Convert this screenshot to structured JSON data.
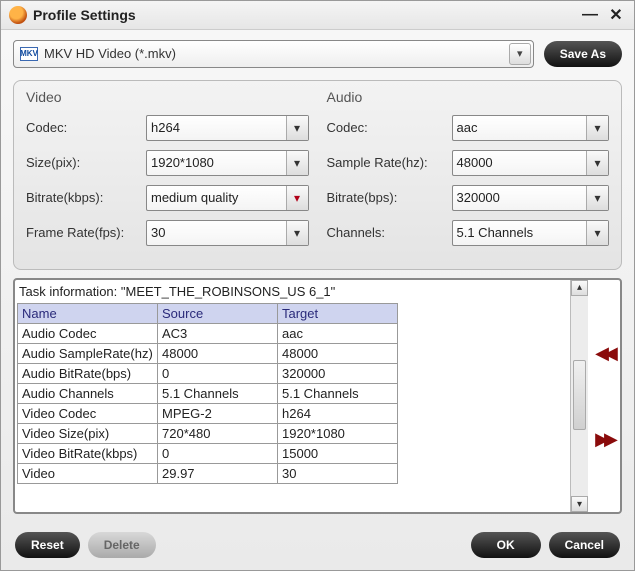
{
  "window": {
    "title": "Profile Settings"
  },
  "toolbar": {
    "profile_value": "MKV HD Video (*.mkv)",
    "save_as_label": "Save As"
  },
  "video": {
    "heading": "Video",
    "codec_label": "Codec:",
    "codec_value": "h264",
    "size_label": "Size(pix):",
    "size_value": "1920*1080",
    "bitrate_label": "Bitrate(kbps):",
    "bitrate_value": "medium quality",
    "fps_label": "Frame Rate(fps):",
    "fps_value": "30"
  },
  "audio": {
    "heading": "Audio",
    "codec_label": "Codec:",
    "codec_value": "aac",
    "sr_label": "Sample Rate(hz):",
    "sr_value": "48000",
    "bitrate_label": "Bitrate(bps):",
    "bitrate_value": "320000",
    "channels_label": "Channels:",
    "channels_value": "5.1 Channels"
  },
  "task": {
    "info": "Task information: \"MEET_THE_ROBINSONS_US 6_1\"",
    "header_name": "Name",
    "header_source": "Source",
    "header_target": "Target",
    "rows": [
      {
        "name": "Audio Codec",
        "source": "AC3",
        "target": "aac"
      },
      {
        "name": "Audio SampleRate(hz)",
        "source": "48000",
        "target": "48000"
      },
      {
        "name": "Audio BitRate(bps)",
        "source": "0",
        "target": "320000"
      },
      {
        "name": "Audio Channels",
        "source": "5.1 Channels",
        "target": "5.1 Channels"
      },
      {
        "name": "Video Codec",
        "source": "MPEG-2",
        "target": "h264"
      },
      {
        "name": "Video Size(pix)",
        "source": "720*480",
        "target": "1920*1080"
      },
      {
        "name": "Video BitRate(kbps)",
        "source": "0",
        "target": "15000"
      },
      {
        "name": "Video",
        "source": "29.97",
        "target": "30"
      }
    ]
  },
  "footer": {
    "reset_label": "Reset",
    "delete_label": "Delete",
    "ok_label": "OK",
    "cancel_label": "Cancel"
  }
}
